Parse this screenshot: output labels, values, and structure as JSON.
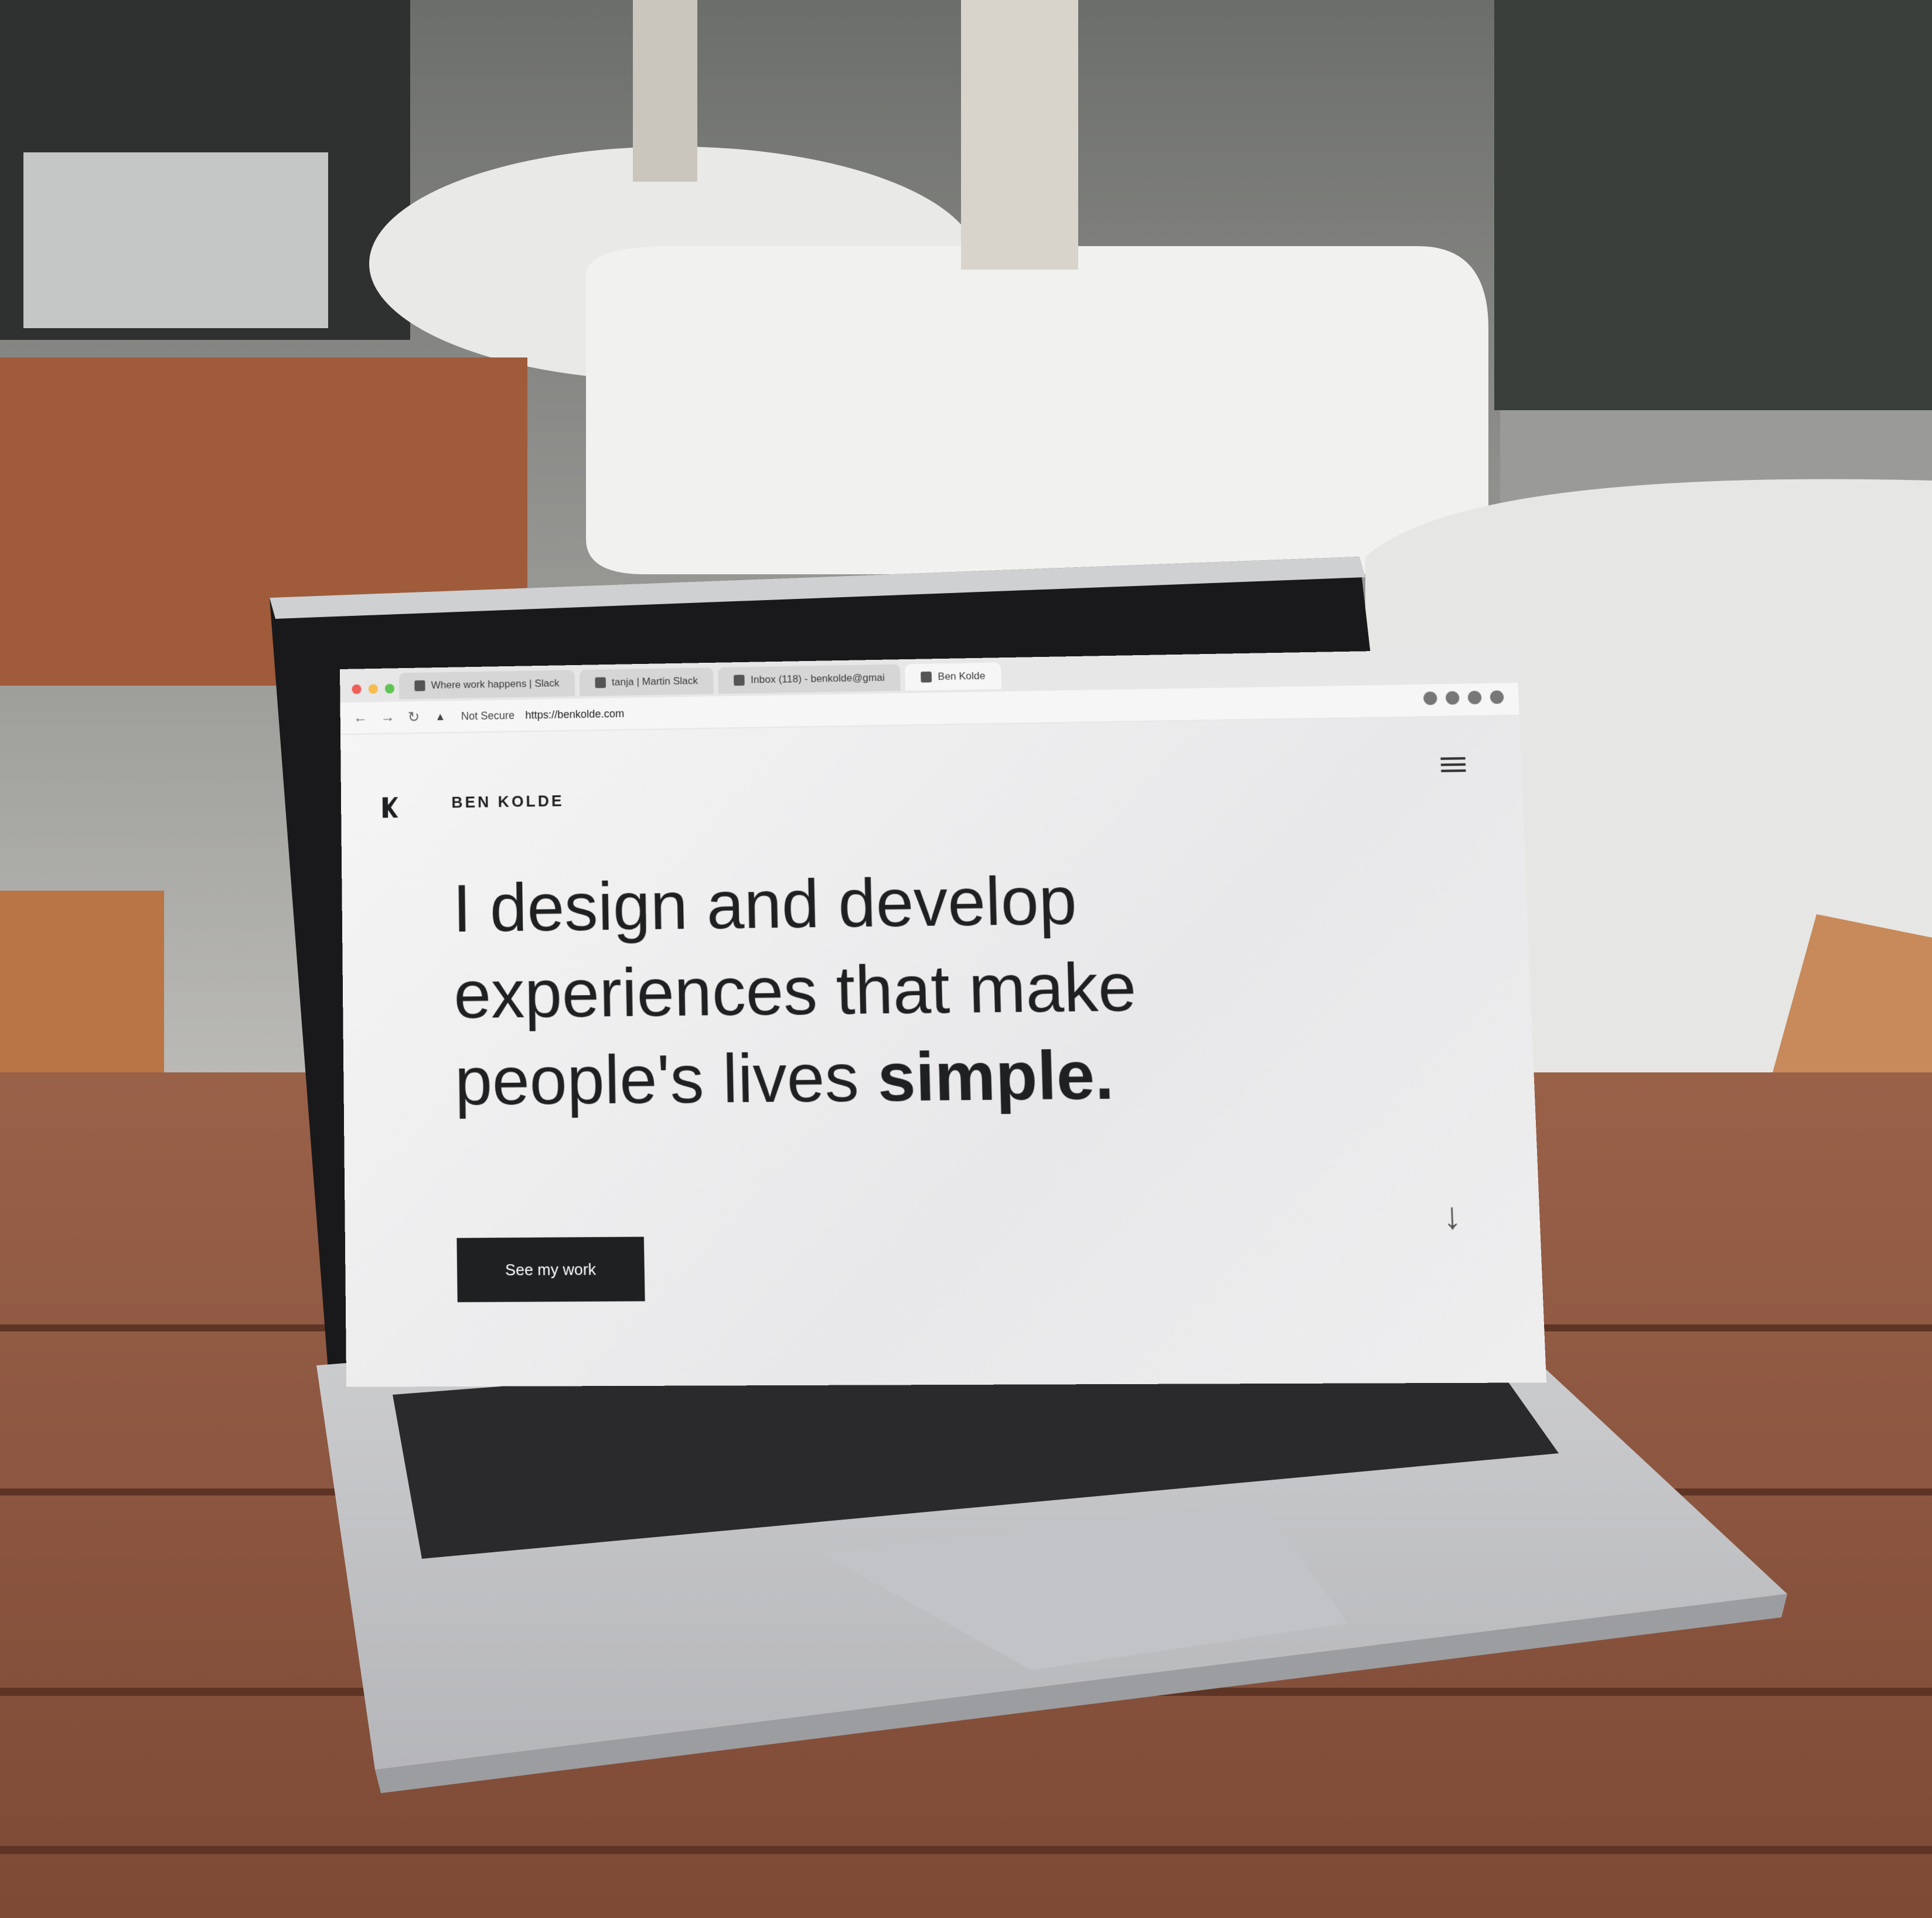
{
  "browser": {
    "tabs": [
      {
        "label": "Where work happens | Slack"
      },
      {
        "label": "tanja | Martin Slack"
      },
      {
        "label": "Inbox (118) - benkolde@gmai"
      },
      {
        "label": "Ben Kolde"
      }
    ],
    "security_label": "Not Secure",
    "url": "https://benkolde.com"
  },
  "site": {
    "brand": "BEN KOLDE",
    "hero_line1": "I design and develop",
    "hero_line2": "experiences that make",
    "hero_line3_prefix": "people's lives ",
    "hero_emphasis": "simple.",
    "cta_label": "See my work"
  },
  "colors": {
    "text_dark": "#1f2022",
    "page_bg": "#eeeeef",
    "button_bg": "#1f2022"
  }
}
